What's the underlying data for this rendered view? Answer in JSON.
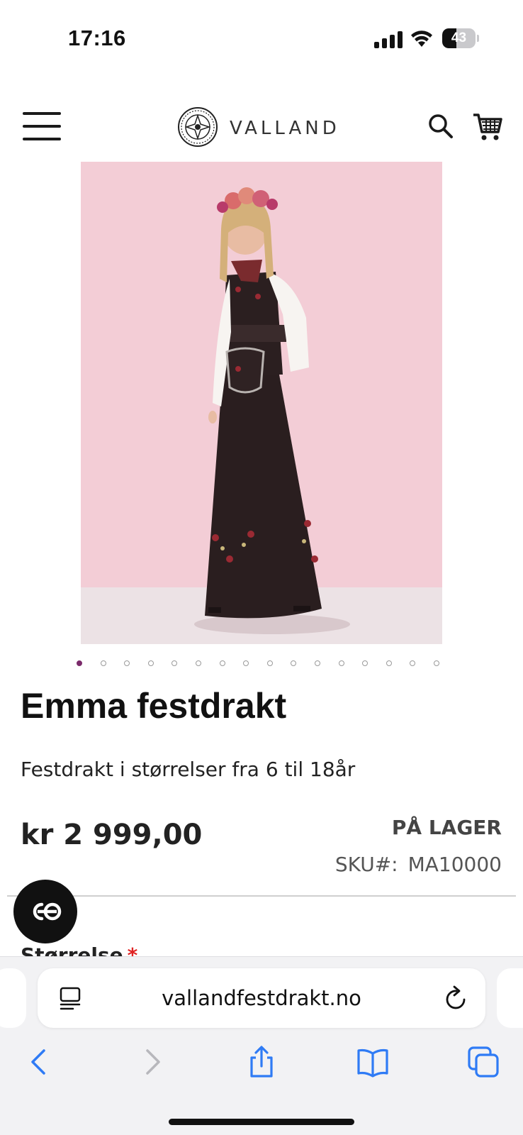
{
  "status_bar": {
    "time": "17:16",
    "battery": "43",
    "battery_level": 0.43
  },
  "header": {
    "brand": "VALLAND"
  },
  "carousel": {
    "count": 16,
    "active": 0
  },
  "product": {
    "title": "Emma festdrakt",
    "description": "Festdrakt i størrelser fra 6 til 18år",
    "price": "kr 2 999,00",
    "stock": "PÅ LAGER",
    "sku_label": "SKU#:",
    "sku_value": "MA10000",
    "size_label": "Størrelse",
    "required_mark": "*"
  },
  "browser": {
    "url": "vallandfestdrakt.no"
  },
  "colors": {
    "accent": "#7b2a6b",
    "safari_blue": "#2f7bf5",
    "required": "#e02424"
  }
}
